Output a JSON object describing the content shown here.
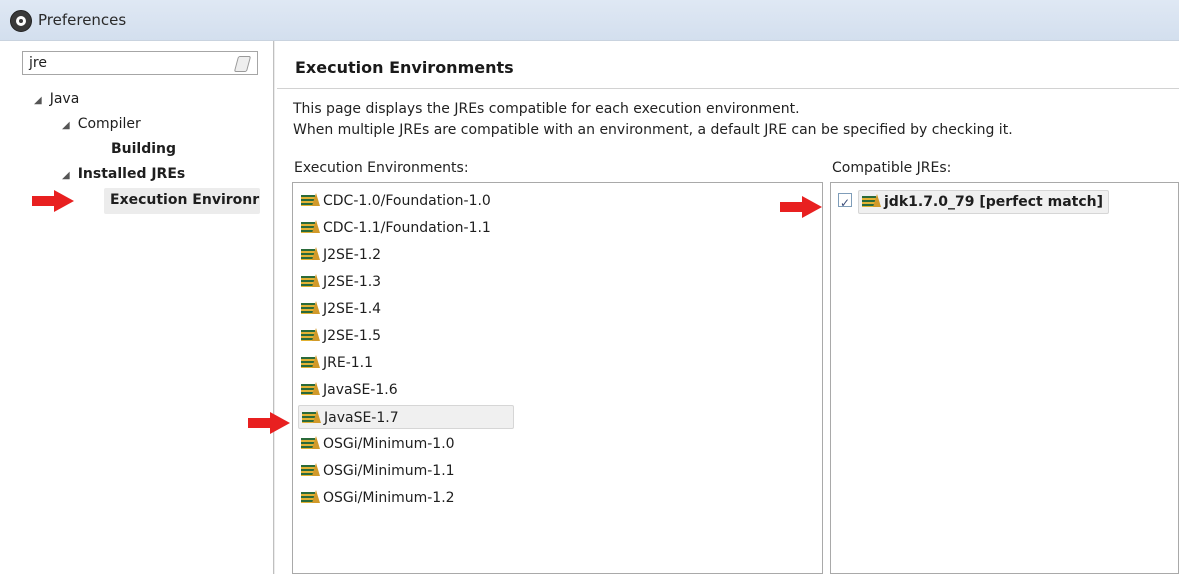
{
  "window": {
    "title": "Preferences"
  },
  "search": {
    "value": "jre"
  },
  "tree": {
    "java": "Java",
    "compiler": "Compiler",
    "building": "Building",
    "installed_jres": "Installed JREs",
    "execution_environments": "Execution Environr"
  },
  "main": {
    "title": "Execution Environments",
    "desc_line1": "This page displays the JREs compatible for each execution environment.",
    "desc_line2": "When multiple JREs are compatible with an environment, a default JRE can be specified by checking it.",
    "env_label": "Execution Environments:",
    "jre_label": "Compatible JREs:"
  },
  "environments": [
    "CDC-1.0/Foundation-1.0",
    "CDC-1.1/Foundation-1.1",
    "J2SE-1.2",
    "J2SE-1.3",
    "J2SE-1.4",
    "J2SE-1.5",
    "JRE-1.1",
    "JavaSE-1.6",
    "JavaSE-1.7",
    "OSGi/Minimum-1.0",
    "OSGi/Minimum-1.1",
    "OSGi/Minimum-1.2"
  ],
  "selected_environment": "JavaSE-1.7",
  "compatible_jres": [
    {
      "label": "jdk1.7.0_79 [perfect match]",
      "checked": true
    }
  ],
  "colors": {
    "arrow": "#e82020",
    "selection": "#f0f0f0"
  }
}
